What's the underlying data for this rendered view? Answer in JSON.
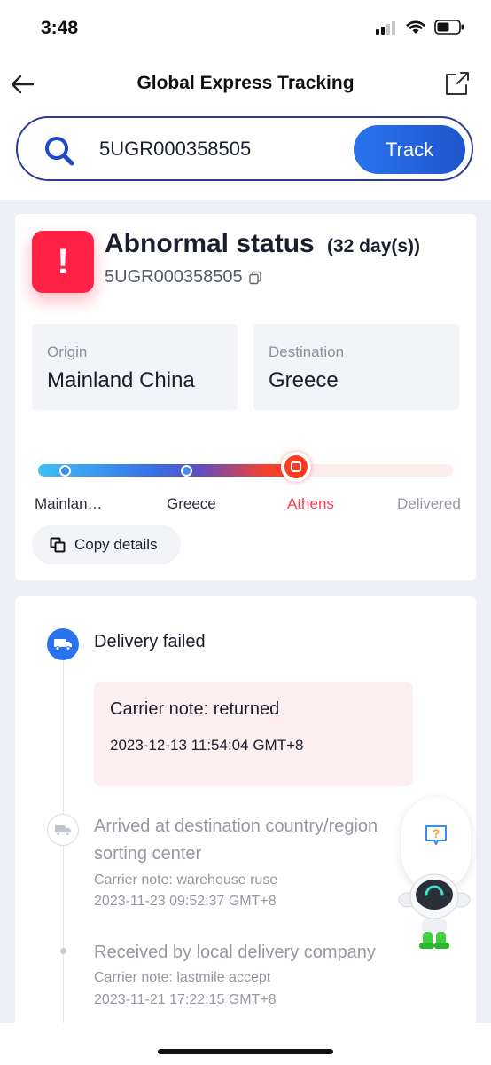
{
  "status_bar": {
    "time": "3:48"
  },
  "nav": {
    "title": "Global Express Tracking"
  },
  "search": {
    "value": "5UGR000358505",
    "button_label": "Track"
  },
  "summary": {
    "status_title": "Abnormal status",
    "days": "(32 day(s))",
    "tracking_number": "5UGR000358505",
    "alert_glyph": "!",
    "origin_label": "Origin",
    "origin_value": "Mainland China",
    "destination_label": "Destination",
    "destination_value": "Greece",
    "progress": {
      "stages": [
        "Mainlan…",
        "Greece",
        "Athens",
        "Delivered"
      ],
      "current_stage_index": 2,
      "fill_fraction": 0.62
    },
    "copy_label": "Copy details"
  },
  "timeline": [
    {
      "title": "Delivery failed",
      "note": "Carrier note: returned",
      "time": "2023-12-13 11:54:04 GMT+8"
    },
    {
      "title_line1": "Arrived at destination country/region",
      "title_line2": "sorting center",
      "note": "Carrier note: warehouse ruse",
      "time": "2023-11-23 09:52:37 GMT+8"
    },
    {
      "title": "Received by local delivery company",
      "note": "Carrier note: lastmile accept",
      "time": "2023-11-21 17:22:15 GMT+8"
    }
  ],
  "colors": {
    "accent": "#2a73ef",
    "alert": "#ff2146",
    "current_stage": "#ff3b1f"
  }
}
